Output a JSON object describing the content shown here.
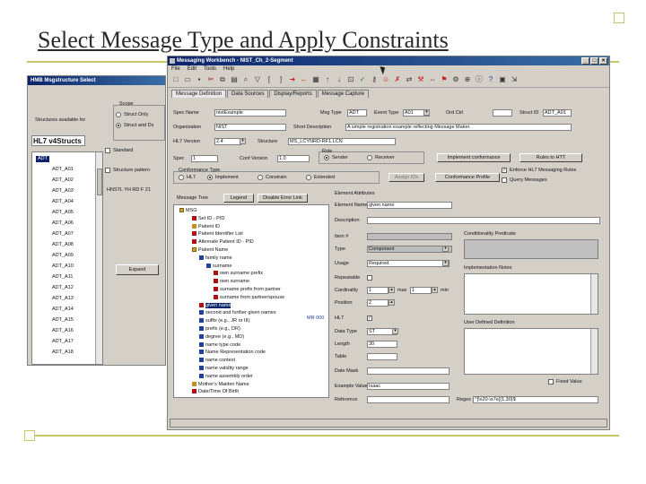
{
  "slide": {
    "title": "Select Message Type and Apply Constraints"
  },
  "dialog": {
    "title": "HMB Msgstructure Select",
    "scope_label": "Scope",
    "structures_label": "Structures available for",
    "option_structure_only": "Struct Only",
    "option_struct_and_ds": "Struct and Ds",
    "version": "HL7 v4Structs",
    "standard_label": "Standard",
    "structure_pattern": "Structure pattern",
    "default_structure": "HNSTL YH RD F 21",
    "expand_label": "Expand",
    "items": [
      "ADT",
      "ADT_A01",
      "ADT_A02",
      "ADT_A03",
      "ADT_A04",
      "ADT_A05",
      "ADT_A06",
      "ADT_A07",
      "ADT_A08",
      "ADT_A09",
      "ADT_A10",
      "ADT_A11",
      "ADT_A12",
      "ADT_A13",
      "ADT_A14",
      "ADT_A15",
      "ADT_A16",
      "ADT_A17",
      "ADT_A18"
    ]
  },
  "wb": {
    "title": "Messaging Workbench - NIST_Ch_2-Segment",
    "menus": [
      "File",
      "Edit",
      "Tools",
      "Help"
    ],
    "tabs": [
      "Message Definition",
      "Data Sources",
      "Display/Reports",
      "Message Capture"
    ],
    "form": {
      "spec_name_label": "Spec Name",
      "spec_name": "nistExample",
      "msg_type_label": "Msg Type",
      "msg_type": "ADT",
      "event_type_label": "Event Type",
      "event_type": "A01",
      "ord_ctrl_label": "Ord Ctrl",
      "ord_ctrl": "",
      "struct_id_label": "Struct ID",
      "struct_id": "ADT_A01",
      "organization_label": "Organization",
      "organization": "NIST",
      "description_label": "Short Description",
      "description": "A simple registration example reflecting Message Maker.",
      "version_label": "HL7 Version",
      "version": "2.4",
      "structure_label": "Structure",
      "structure": "MS_LCYNRD-RF1.LCN",
      "spec_label": "Spec",
      "spec": "1",
      "spec_version_label": "Conf Version",
      "spec_version": "1.0",
      "role_label": "Role",
      "role_sender": "Sender",
      "role_receiver": "Receiver",
      "impl_conformance": "Implement conformance",
      "rules_label": "Rules to HTT",
      "conformance_type_label": "Conformance Type",
      "ct_options": [
        "HL7",
        "Implement",
        "Constrain",
        "Extended"
      ],
      "assign_ids": "Assign IDs",
      "conformance_profile": "Conformance Profile",
      "cb1": "Enforce HL7 Messaging Rules",
      "cb2": "Query Messages"
    },
    "tree": {
      "title": "Message Tree",
      "legend": "Legend",
      "disable_btn": "Disable Error Link",
      "rows": [
        "MSG",
        "Set ID - PID",
        "Patient ID",
        "Patient Identifier List",
        "Alternate Patient ID - PID",
        "Patient Name",
        "family name",
        "surname",
        "own surname prefix",
        "own surname",
        "surname prefix from partner",
        "surname from partner/spouse",
        "given name",
        "second and further given names",
        "suffix (e.g., JR or III)",
        "prefix (e.g., DR)",
        "degree (e.g., MD)",
        "name type code",
        "Name Representation code",
        "name context",
        "name validity range",
        "name assembly order",
        "Mother's Maiden Name",
        "Date/Time Of Birth"
      ]
    },
    "detail": {
      "title": "Element Attributes",
      "element_name_label": "Element Name",
      "element_name": "given name",
      "description_label": "Description",
      "description": "",
      "item_label": "Item #",
      "item": "",
      "type_label": "Type",
      "type": "Component",
      "usage_label": "Usage",
      "usage": "Required",
      "repeatable_label": "Repeatable",
      "cardinality_label": "Cardinality",
      "card_min": "1",
      "max_label": "max",
      "card_max": "1",
      "min_label": "min",
      "position_label": "Position",
      "position": "2",
      "hl7_label": "HL7",
      "data_type_label": "Data Type",
      "data_type": "ST",
      "length_label": "Length",
      "length": "30",
      "table_label": "Table",
      "table": "",
      "date_mask_label": "Date Mask",
      "date_mask": "",
      "example_label": "Example Value",
      "example": "Isaac",
      "reference_label": "Reference",
      "reference": "",
      "regex_label": "Regex",
      "regex": "^[\\x20-\\x7e]{1,30}$",
      "predicate_label": "Conditionality Predicate",
      "impl_notes_label": "Implementation Notes",
      "user_def_label": "User Defined Definition",
      "fixed_label": "Fixed Value",
      "badge": "MR 000"
    }
  },
  "theme": {
    "accent": "#0a246a",
    "rule": "#c8c86a"
  }
}
